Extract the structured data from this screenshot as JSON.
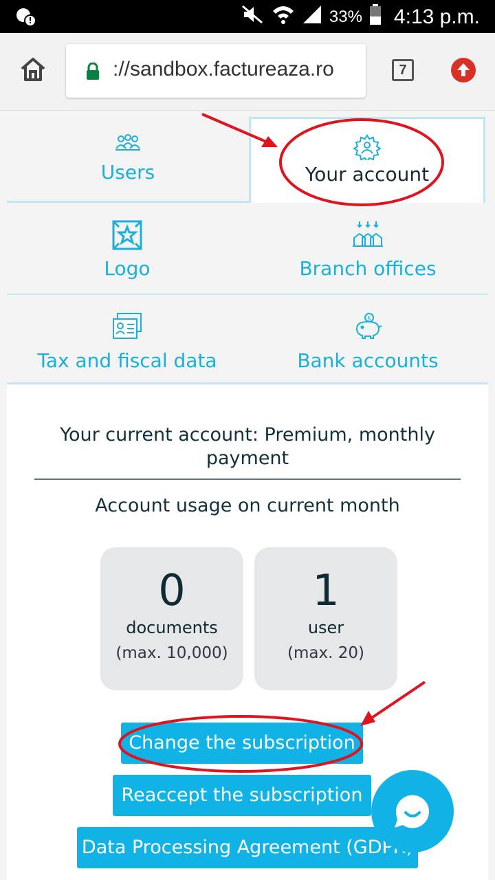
{
  "status_bar": {
    "battery": "33%",
    "time": "4:13 p.m."
  },
  "browser": {
    "url": "://sandbox.factureaza.ro",
    "tab_count": "7"
  },
  "tabs": [
    {
      "label": "Users",
      "icon": "users-icon",
      "active": false
    },
    {
      "label": "Your account",
      "icon": "account-gear-icon",
      "active": true
    }
  ],
  "menu": [
    {
      "label": "Logo",
      "icon": "logo-icon"
    },
    {
      "label": "Branch offices",
      "icon": "branch-offices-icon"
    },
    {
      "label": "Tax and fiscal data",
      "icon": "tax-data-icon"
    },
    {
      "label": "Bank accounts",
      "icon": "piggy-bank-icon"
    }
  ],
  "account": {
    "current": "Your current account: Premium, monthly payment",
    "usage_title": "Account usage on current month",
    "stats": [
      {
        "value": "0",
        "unit": "documents",
        "max": "(max. 10,000)"
      },
      {
        "value": "1",
        "unit": "user",
        "max": "(max. 20)"
      }
    ]
  },
  "buttons": {
    "change": "Change the subscription",
    "reaccept": "Reaccept the subscription",
    "gdpr": "Data Processing Agreement (GDPR)"
  },
  "colors": {
    "accent": "#11b3e6",
    "annotation": "#e0141e"
  }
}
